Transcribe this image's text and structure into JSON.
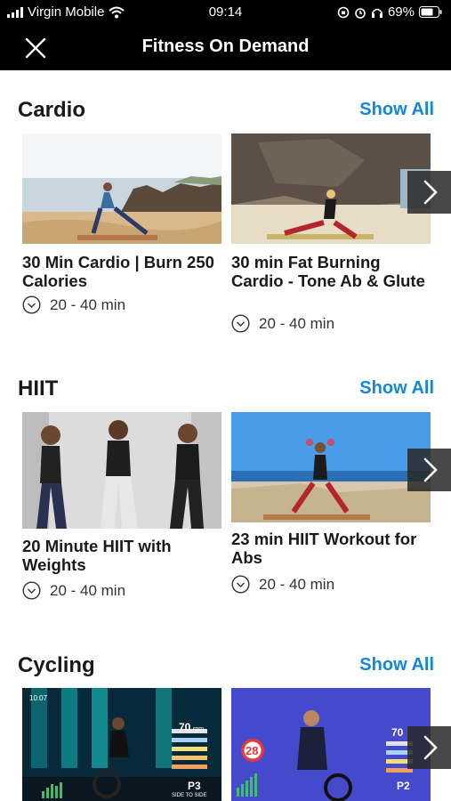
{
  "status_bar": {
    "carrier": "Virgin Mobile",
    "time": "09:14",
    "battery": "69%"
  },
  "header": {
    "title": "Fitness On Demand"
  },
  "sections": [
    {
      "title": "Cardio",
      "show_all": "Show All",
      "cards": [
        {
          "title": "30 Min Cardio | Burn 250 Calories",
          "duration": "20 - 40 min"
        },
        {
          "title": "30 min Fat Burning Cardio - Tone Ab & Glute",
          "duration": "20 - 40 min"
        }
      ]
    },
    {
      "title": "HIIT",
      "show_all": "Show All",
      "cards": [
        {
          "title": "20 Minute HIIT with Weights",
          "duration": "20 - 40 min"
        },
        {
          "title": "23 min HIIT Workout for Abs",
          "duration": "20 - 40 min"
        }
      ]
    },
    {
      "title": "Cycling",
      "show_all": "Show All",
      "cards": [
        {
          "overlay": {
            "clock": "10:07",
            "rpm": "70",
            "rpm_unit": "rpm",
            "position": "P3",
            "move": "SIDE TO SIDE"
          }
        },
        {
          "overlay": {
            "countdown": "28",
            "rpm": "70",
            "position": "P2"
          }
        }
      ]
    }
  ],
  "colors": {
    "accent": "#1587d8",
    "header_bg": "#000000"
  }
}
